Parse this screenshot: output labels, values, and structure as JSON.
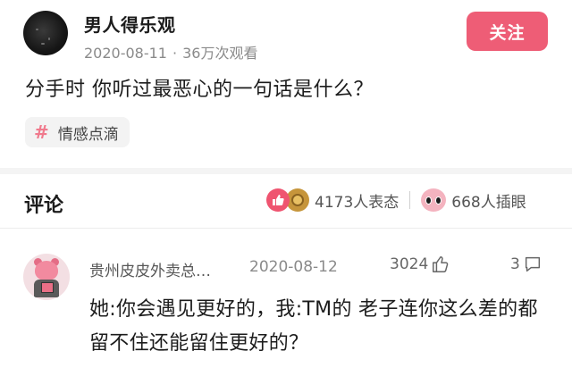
{
  "post": {
    "author": "男人得乐观",
    "date": "2020-08-11",
    "separator": "·",
    "views": "36万次观看",
    "follow_label": "关注",
    "question": "分手时 你听过最恶心的一句话是什么？",
    "tag_icon": "#",
    "tag_label": "情感点滴"
  },
  "comments_header": {
    "title": "评论",
    "reactions_count": "4173人表态",
    "inserts_count": "668人插眼"
  },
  "comment": {
    "user": "贵州皮皮外卖总…",
    "date": "2020-08-12",
    "likes": "3024",
    "replies": "3",
    "text": "她:你会遇见更好的，我:TM的 老子连你这么差的都留不住还能留住更好的？"
  },
  "icons": {
    "follow": "none",
    "tag": "hashtag-icon",
    "reaction1": "thumbs-up-icon",
    "reaction2": "coin-icon",
    "reaction3": "eyes-icon",
    "like": "thumbs-up-outline-icon",
    "reply": "speech-bubble-icon"
  },
  "colors": {
    "accent": "#ee5d76",
    "text": "#1c1c1c",
    "muted": "#8a8a8a",
    "tag_bg": "#f3f3f3"
  }
}
